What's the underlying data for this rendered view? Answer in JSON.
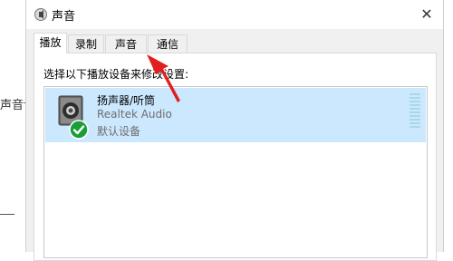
{
  "background": {
    "partial_text": "声音设"
  },
  "window": {
    "title": "声音",
    "close_glyph": "✕"
  },
  "tabs": [
    {
      "label": "播放",
      "active": true
    },
    {
      "label": "录制",
      "active": false
    },
    {
      "label": "声音",
      "active": false
    },
    {
      "label": "通信",
      "active": false
    }
  ],
  "playback": {
    "instruction": "选择以下播放设备来修改设置:",
    "devices": [
      {
        "name": "扬声器/听筒",
        "driver": "Realtek Audio",
        "status": "默认设备",
        "selected": true,
        "icon": "speaker-icon",
        "status_icon": "default-check-icon"
      }
    ]
  },
  "annotation": {
    "type": "arrow",
    "color": "#e02020"
  },
  "colors": {
    "selection": "#cce8ff",
    "check": "#1a9e3a"
  }
}
